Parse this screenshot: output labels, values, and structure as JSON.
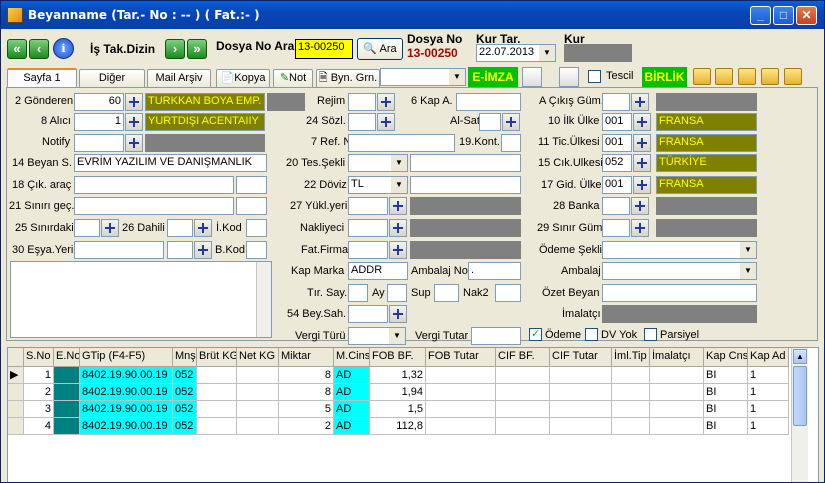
{
  "window": {
    "title": "Beyanname (Tar.- No :  -- ) ( Fat.:- )",
    "min": "_",
    "max": "□",
    "close": "✕"
  },
  "toolbar": {
    "is_takip": "İş Tak.Dizin",
    "dosya_no_ara_label": "Dosya No Ara",
    "dosya_no_ara_value": "13-00250",
    "ara_button": "Ara",
    "dosya_no_label": "Dosya No",
    "dosya_no_value": "13-00250",
    "kur_tar_label": "Kur Tar.",
    "kur_tar_value": "22.07.2013",
    "kur_label": "Kur"
  },
  "tabs": [
    {
      "label": "Sayfa 1"
    },
    {
      "label": "Diğer Formlar"
    },
    {
      "label": "Mail Arşiv"
    },
    {
      "label": "Kopya"
    },
    {
      "label": "Not"
    },
    {
      "label": "Byn. Grn."
    }
  ],
  "eimza": "E-İMZA",
  "tescil": "Tescil",
  "birlik": "BİRLİK",
  "form": {
    "gonderen_label": "2 Gönderen",
    "gonderen_no": "60",
    "gonderen_name": "TURKKAN BOYA EMP.",
    "alici_label": "8 Alıcı",
    "alici_no": "1",
    "alici_name": "YURTDIŞI ACENTAIIY",
    "notify_label": "Notify",
    "beyan_label": "14 Beyan S.",
    "beyan_value": "EVRİM YAZILIM VE DANIŞMANLIK",
    "cik_arac_label": "18 Çık. araç",
    "sinir_gec_label": "21 Sınırı geç.",
    "sinirdaki_label": "25 Sınırdaki",
    "dahili_label": "26 Dahili",
    "ikod_label": "İ.Kod",
    "esya_yeri_label": "30 Eşya.Yeri",
    "bkod_label": "B.Kod",
    "rejim_label": "Rejim",
    "kap_a_label": "6 Kap A.",
    "sozl_label": "24 Sözl.",
    "al_sat_label": "Al-Sat",
    "ref_no_label": "7 Ref. No",
    "kont_label": "19.Kont.",
    "tes_sekli_label": "20 Tes.Şekli",
    "doviz_label": "22 Döviz",
    "doviz_value": "TL",
    "yukl_yeri_label": "27 Yükl.yeri",
    "nakliyeci_label": "Nakliyeci",
    "fat_firma_label": "Fat.Firma",
    "kap_marka_label": "Kap Marka",
    "kap_marka_value": "ADDR",
    "ambalaj_no_label": "Ambalaj No",
    "ambalaj_no_value": ".",
    "tir_say_label": "Tır. Say.",
    "ay_label": "Ay",
    "sup_label": "Sup",
    "nak2_label": "Nak2",
    "bey_sah_label": "54 Bey.Sah.",
    "vergi_turu_label": "Vergi Türü",
    "vergi_tutar_label": "Vergi Tutar",
    "cikis_gum_label": "A Çıkış Güm.",
    "ilk_ulke_label": "10 İlk Ülke",
    "ilk_ulke_code": "001",
    "ilk_ulke_name": "FRANSA",
    "tic_ulkesi_label": "11 Tic.Ülkesi",
    "tic_ulkesi_code": "001",
    "tic_ulkesi_name": "FRANSA",
    "cik_ulkesi_label": "15 Cık.Ulkesi",
    "cik_ulkesi_code": "052",
    "cik_ulkesi_name": "TÜRKİYE",
    "gid_ulke_label": "17 Gid. Ülke",
    "gid_ulke_code": "001",
    "gid_ulke_name": "FRANSA",
    "banka_label": "28 Banka",
    "sinir_gum_label": "29 Sınır Güm.",
    "odeme_sekli_label": "Ödeme Şekli",
    "ambalaj_label": "Ambalaj",
    "ozet_beyan_label": "Özet Beyan",
    "imalatci_label": "İmalatçı",
    "odeme_chk": "Ödeme",
    "dv_yok_chk": "DV Yok",
    "parsiyel_chk": "Parsiyel"
  },
  "grid": {
    "headers": [
      "S.No",
      "E.No",
      "GTip (F4-F5)",
      "Mnş",
      "Brüt KG",
      "Net KG",
      "Miktar",
      "M.Cins",
      "FOB BF.",
      "FOB Tutar",
      "CIF BF.",
      "CIF Tutar",
      "İml.Tip",
      "İmalatçı",
      "Kap Cns",
      "Kap Ad"
    ],
    "rows": [
      {
        "sno": "1",
        "gtip": "8402.19.90.00.19",
        "mns": "052",
        "miktar": "8",
        "mcins": "AD",
        "fob": "1,32",
        "kapcns": "BI",
        "kapad": "1"
      },
      {
        "sno": "2",
        "gtip": "8402.19.90.00.19",
        "mns": "052",
        "miktar": "8",
        "mcins": "AD",
        "fob": "1,94",
        "kapcns": "BI",
        "kapad": "1"
      },
      {
        "sno": "3",
        "gtip": "8402.19.90.00.19",
        "mns": "052",
        "miktar": "5",
        "mcins": "AD",
        "fob": "1,5",
        "kapcns": "BI",
        "kapad": "1"
      },
      {
        "sno": "4",
        "gtip": "8402.19.90.00.19",
        "mns": "052",
        "miktar": "2",
        "mcins": "AD",
        "fob": "112,8",
        "kapcns": "BI",
        "kapad": "1"
      }
    ]
  }
}
